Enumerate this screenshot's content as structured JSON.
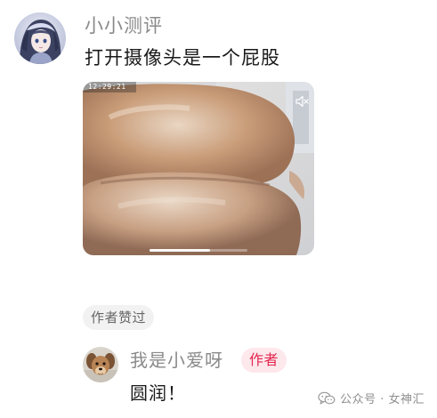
{
  "comment": {
    "username": "小小测评",
    "text": "打开摄像头是一个屁股",
    "avatar_icon": "anime-girl-avatar",
    "video": {
      "timestamp": "12:29:21",
      "mute_icon": "speaker-muted-icon",
      "progress": 0.62
    }
  },
  "liked_badge": "作者赞过",
  "reply": {
    "username": "我是小爱呀",
    "author_tag": "作者",
    "text": "圆润！",
    "avatar_icon": "dog-avatar"
  },
  "watermark": {
    "icon": "wechat-icon",
    "text": "公众号 · 女神汇"
  },
  "colors": {
    "author_tag_text": "#e2264d",
    "author_tag_bg": "#fde8ec",
    "name_gray": "#8a8a8a"
  }
}
